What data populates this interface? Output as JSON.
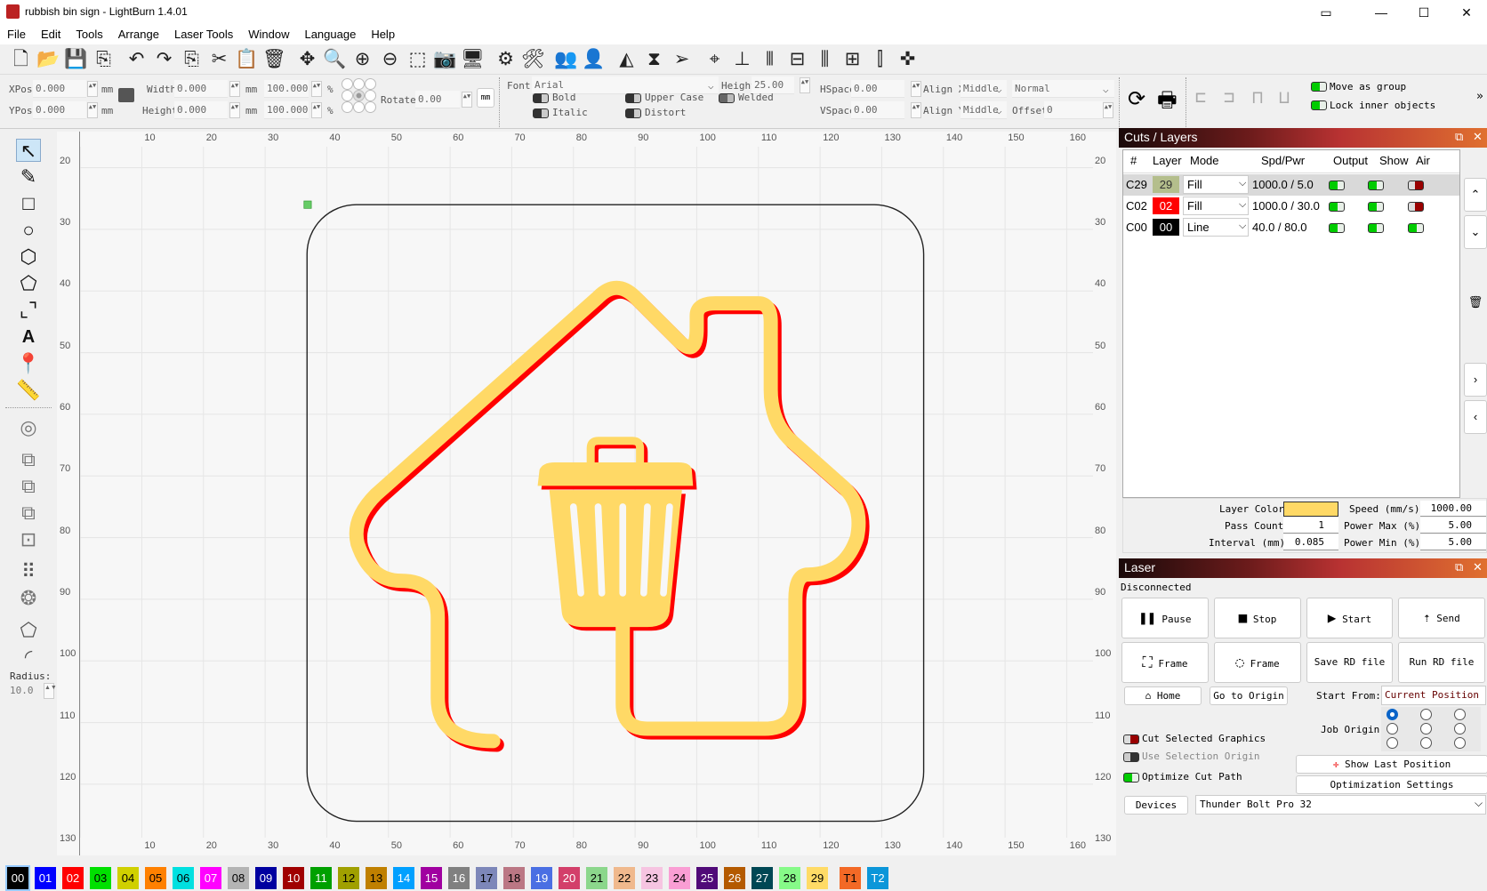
{
  "window": {
    "title": "rubbish bin sign - LightBurn 1.4.01"
  },
  "menu": [
    "File",
    "Edit",
    "Tools",
    "Arrange",
    "Laser Tools",
    "Window",
    "Language",
    "Help"
  ],
  "toolbar_icons": [
    "new-file-icon",
    "open-icon",
    "save-icon",
    "export-icon",
    "undo-icon",
    "redo-icon",
    "copy-icon",
    "cut-icon",
    "paste-icon",
    "delete-icon",
    "move-icon",
    "zoom-tool-icon",
    "zoom-in-icon",
    "zoom-out-icon",
    "zoom-frame-icon",
    "camera-icon",
    "monitor-icon",
    "settings-icon",
    "machine-settings-icon",
    "group-icon",
    "ungroup-icon",
    "mirror-h-icon",
    "mirror-v-icon",
    "send-icon",
    "target-icon",
    "align-icon",
    "distribute-icon",
    "align-center-icon",
    "align-middle-icon",
    "dock-icon",
    "space-icon",
    "center-icon"
  ],
  "props": {
    "xpos_label": "XPos",
    "xpos": "0.000",
    "ypos_label": "YPos",
    "ypos": "0.000",
    "unit": "mm",
    "width_label": "Width",
    "width": "0.000",
    "height_label": "Height",
    "height": "0.000",
    "scale_w": "100.000",
    "scale_h": "100.000",
    "pct": "%",
    "rotate_label": "Rotate",
    "rotate": "0.00",
    "units_btn": "mm",
    "font_label": "Font",
    "font": "Arial",
    "text_height_label": "Height",
    "text_height": "25.00",
    "hspace_label": "HSpace",
    "hspace": "0.00",
    "vspace_label": "VSpace",
    "vspace": "0.00",
    "alignx_label": "Align X",
    "alignx": "Middle",
    "aligny_label": "Align Y",
    "aligny": "Middle",
    "mode": "Normal",
    "offset_label": "Offset",
    "offset": "0",
    "bold": "Bold",
    "italic": "Italic",
    "upper": "Upper Case",
    "distort": "Distort",
    "welded": "Welded",
    "move_group": "Move as group",
    "lock_inner": "Lock inner objects",
    "more": "»"
  },
  "tools": {
    "radius_label": "Radius:",
    "radius": "10.0"
  },
  "ruler": {
    "x": [
      10,
      20,
      30,
      40,
      50,
      60,
      70,
      80,
      90,
      100,
      110,
      120,
      130,
      140,
      150,
      160
    ],
    "y": [
      20,
      30,
      40,
      50,
      60,
      70,
      80,
      90,
      100,
      110,
      120,
      130
    ]
  },
  "colors": {
    "fill": "#FFD966",
    "red": "#FF0000",
    "outline": "#222222"
  },
  "cuts": {
    "title": "Cuts / Layers",
    "headers": [
      "#",
      "Layer",
      "Mode",
      "Spd/Pwr",
      "Output",
      "Show",
      "Air"
    ],
    "rows": [
      {
        "id": "C29",
        "layer": "29",
        "color": "#B4BE8C",
        "mode": "Fill",
        "spdpwr": "1000.0 / 5.0",
        "output": true,
        "show": true,
        "air": false
      },
      {
        "id": "C02",
        "layer": "02",
        "color": "#FF0000",
        "mode": "Fill",
        "spdpwr": "1000.0 / 30.0",
        "output": true,
        "show": true,
        "air": false
      },
      {
        "id": "C00",
        "layer": "00",
        "color": "#000000",
        "mode": "Line",
        "spdpwr": "40.0 / 80.0",
        "output": true,
        "show": true,
        "air": true
      }
    ]
  },
  "layer_settings": {
    "color_label": "Layer Color",
    "color": "#FFD966",
    "speed_label": "Speed (mm/s)",
    "speed": "1000.00",
    "pass_label": "Pass Count",
    "pass": "1",
    "pmax_label": "Power Max (%)",
    "pmax": "5.00",
    "interval_label": "Interval (mm)",
    "interval": "0.085",
    "pmin_label": "Power Min (%)",
    "pmin": "5.00"
  },
  "laser": {
    "title": "Laser",
    "status": "Disconnected",
    "pause": "Pause",
    "stop": "Stop",
    "start": "Start",
    "send": "Send",
    "frame1": "Frame",
    "frame2": "Frame",
    "save_rd": "Save RD file",
    "run_rd": "Run RD file",
    "home": "Home",
    "go_origin": "Go to Origin",
    "start_from_label": "Start From:",
    "start_from": "Current Position",
    "job_origin_label": "Job Origin",
    "cut_selected": "Cut Selected Graphics",
    "use_sel_origin": "Use Selection Origin",
    "optimize": "Optimize Cut Path",
    "show_last": "Show Last Position",
    "opt_settings": "Optimization Settings",
    "devices": "Devices",
    "device": "Thunder Bolt Pro 32"
  },
  "palette": [
    {
      "l": "00",
      "c": "#000000",
      "t": "#fff"
    },
    {
      "l": "01",
      "c": "#0000FF",
      "t": "#fff"
    },
    {
      "l": "02",
      "c": "#FF0000",
      "t": "#fff"
    },
    {
      "l": "03",
      "c": "#00E000",
      "t": "#000"
    },
    {
      "l": "04",
      "c": "#D0D000",
      "t": "#000"
    },
    {
      "l": "05",
      "c": "#FF8000",
      "t": "#000"
    },
    {
      "l": "06",
      "c": "#00E0E0",
      "t": "#000"
    },
    {
      "l": "07",
      "c": "#FF00FF",
      "t": "#fff"
    },
    {
      "l": "08",
      "c": "#B4B4B4",
      "t": "#000"
    },
    {
      "l": "09",
      "c": "#0000A0",
      "t": "#fff"
    },
    {
      "l": "10",
      "c": "#A00000",
      "t": "#fff"
    },
    {
      "l": "11",
      "c": "#00A000",
      "t": "#fff"
    },
    {
      "l": "12",
      "c": "#A0A000",
      "t": "#000"
    },
    {
      "l": "13",
      "c": "#C08000",
      "t": "#000"
    },
    {
      "l": "14",
      "c": "#00A0FF",
      "t": "#fff"
    },
    {
      "l": "15",
      "c": "#A000A0",
      "t": "#fff"
    },
    {
      "l": "16",
      "c": "#808080",
      "t": "#fff"
    },
    {
      "l": "17",
      "c": "#7D87B9",
      "t": "#000"
    },
    {
      "l": "18",
      "c": "#BB7784",
      "t": "#000"
    },
    {
      "l": "19",
      "c": "#4A6FE3",
      "t": "#fff"
    },
    {
      "l": "20",
      "c": "#D33F6A",
      "t": "#fff"
    },
    {
      "l": "21",
      "c": "#8CD78C",
      "t": "#000"
    },
    {
      "l": "22",
      "c": "#F0B98D",
      "t": "#000"
    },
    {
      "l": "23",
      "c": "#F6C4E1",
      "t": "#000"
    },
    {
      "l": "24",
      "c": "#FA9ED4",
      "t": "#000"
    },
    {
      "l": "25",
      "c": "#500A78",
      "t": "#fff"
    },
    {
      "l": "26",
      "c": "#B45A00",
      "t": "#fff"
    },
    {
      "l": "27",
      "c": "#004754",
      "t": "#fff"
    },
    {
      "l": "28",
      "c": "#86FA88",
      "t": "#000"
    },
    {
      "l": "29",
      "c": "#FFDB66",
      "t": "#000"
    },
    {
      "l": "T1",
      "c": "#F36926",
      "t": "#000"
    },
    {
      "l": "T2",
      "c": "#0C96D9",
      "t": "#fff"
    }
  ]
}
